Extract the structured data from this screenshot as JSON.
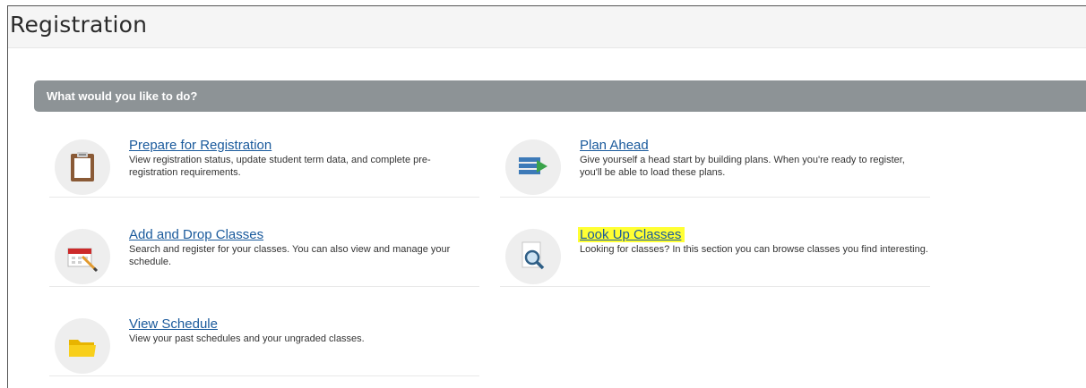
{
  "page": {
    "title": "Registration"
  },
  "section": {
    "title": "What would you like to do?"
  },
  "options": [
    {
      "label": "Prepare for Registration",
      "description": "View registration status, update student term data, and complete pre-registration requirements.",
      "icon": "clipboard-icon"
    },
    {
      "label": "Plan Ahead",
      "description": "Give yourself a head start by building plans. When you're ready to register, you'll be able to load these plans.",
      "icon": "plan-list-icon"
    },
    {
      "label": "Add and Drop Classes",
      "description": "Search and register for your classes. You can also view and manage your schedule.",
      "icon": "calendar-pencil-icon"
    },
    {
      "label": "Look Up Classes",
      "description": "Looking for classes? In this section you can browse classes you find interesting.",
      "icon": "magnifier-document-icon",
      "highlight_color": "#ffff33"
    },
    {
      "label": "View Schedule",
      "description": "View your past schedules and your ungraded classes.",
      "icon": "folder-icon"
    }
  ],
  "colors": {
    "section_header": "#8d9396",
    "link": "#1a5a9c",
    "highlight": "#ffff33"
  }
}
